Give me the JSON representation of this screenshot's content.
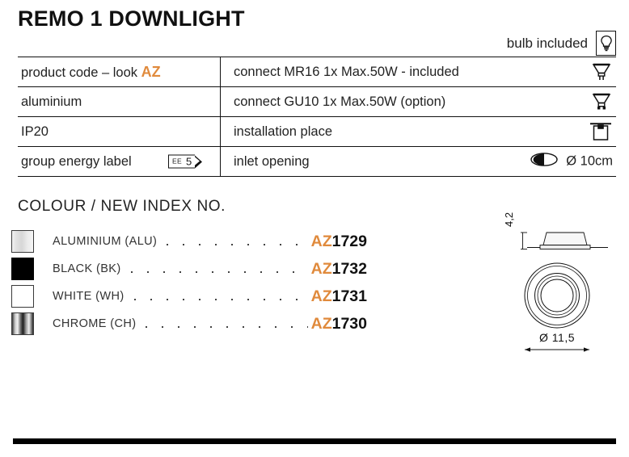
{
  "header": {
    "title": "REMO 1 DOWNLIGHT",
    "bulb_included_label": "bulb included",
    "bulb_icon": "light-bulb-icon"
  },
  "accent_color": "#e08a3c",
  "spec_table": {
    "rows": [
      {
        "left": "product code – look ",
        "left_accent": "AZ",
        "right": "connect MR16 1x Max.50W - included",
        "right_icon": "mr16-lamp-icon"
      },
      {
        "left": "aluminium",
        "left_accent": "",
        "right": "connect GU10 1x Max.50W (option)",
        "right_icon": "gu10-lamp-icon"
      },
      {
        "left": "IP20",
        "left_accent": "",
        "right": "installation place",
        "right_icon": "ceiling-recessed-icon"
      },
      {
        "left": "group energy label",
        "left_accent": "",
        "right": "inlet opening",
        "right_icon": "inlet-opening-icon",
        "right_value": "Ø 10cm"
      }
    ],
    "energy_label": {
      "prefix": "EE",
      "value": "5"
    }
  },
  "colour_section": {
    "heading": "COLOUR / NEW INDEX NO.",
    "items": [
      {
        "swatch": "aluminium-swatch",
        "name": "ALUMINIUM (ALU)",
        "code_prefix": "AZ",
        "code_number": "1729"
      },
      {
        "swatch": "black-swatch",
        "name": "BLACK (BK)",
        "code_prefix": "AZ",
        "code_number": "1732"
      },
      {
        "swatch": "white-swatch",
        "name": "WHITE (WH)",
        "code_prefix": "AZ",
        "code_number": "1731"
      },
      {
        "swatch": "chrome-swatch",
        "name": "CHROME (CH)",
        "code_prefix": "AZ",
        "code_number": "1730"
      }
    ]
  },
  "drawings": {
    "side_view_dimension": "4,2",
    "top_view_dimension": "Ø 11,5"
  }
}
